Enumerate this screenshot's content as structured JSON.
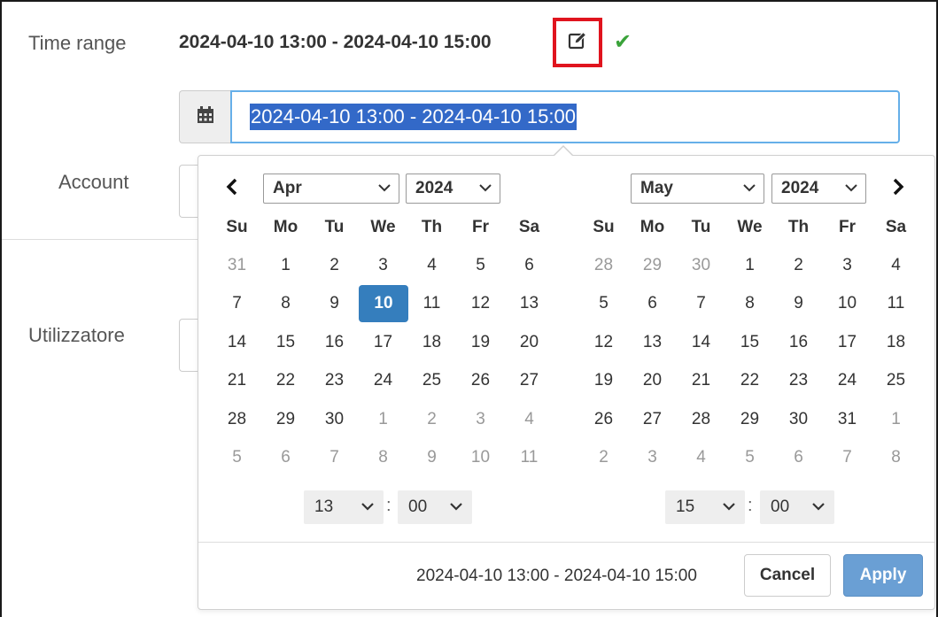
{
  "form": {
    "time_range_label": "Time range",
    "time_range_value": "2024-04-10 13:00 - 2024-04-10 15:00",
    "account_label": "Account",
    "user_label": "Utilizzatore",
    "date_input_value": "2024-04-10 13:00 - 2024-04-10 15:00"
  },
  "icons": {
    "edit": "edit-icon",
    "check": "check-icon",
    "calendar": "calendar-icon",
    "prev": "chevron-left-icon",
    "next": "chevron-right-icon"
  },
  "colors": {
    "highlight_border": "#e0141e",
    "check": "#3aa33a",
    "selection": "#3369c8",
    "active_day": "#357ebd",
    "apply": "#6a9fd4"
  },
  "picker": {
    "left": {
      "month": "Apr",
      "year": "2024",
      "weekdays": [
        "Su",
        "Mo",
        "Tu",
        "We",
        "Th",
        "Fr",
        "Sa"
      ],
      "weeks": [
        [
          "31",
          "1",
          "2",
          "3",
          "4",
          "5",
          "6"
        ],
        [
          "7",
          "8",
          "9",
          "10",
          "11",
          "12",
          "13"
        ],
        [
          "14",
          "15",
          "16",
          "17",
          "18",
          "19",
          "20"
        ],
        [
          "21",
          "22",
          "23",
          "24",
          "25",
          "26",
          "27"
        ],
        [
          "28",
          "29",
          "30",
          "1",
          "2",
          "3",
          "4"
        ],
        [
          "5",
          "6",
          "7",
          "8",
          "9",
          "10",
          "11"
        ]
      ],
      "active_day": "10",
      "hour": "13",
      "minute": "00"
    },
    "right": {
      "month": "May",
      "year": "2024",
      "weekdays": [
        "Su",
        "Mo",
        "Tu",
        "We",
        "Th",
        "Fr",
        "Sa"
      ],
      "weeks": [
        [
          "28",
          "29",
          "30",
          "1",
          "2",
          "3",
          "4"
        ],
        [
          "5",
          "6",
          "7",
          "8",
          "9",
          "10",
          "11"
        ],
        [
          "12",
          "13",
          "14",
          "15",
          "16",
          "17",
          "18"
        ],
        [
          "19",
          "20",
          "21",
          "22",
          "23",
          "24",
          "25"
        ],
        [
          "26",
          "27",
          "28",
          "29",
          "30",
          "31",
          "1"
        ],
        [
          "2",
          "3",
          "4",
          "5",
          "6",
          "7",
          "8"
        ]
      ],
      "hour": "15",
      "minute": "00"
    },
    "time_separator": ":",
    "footer_range": "2024-04-10 13:00 - 2024-04-10 15:00",
    "cancel_label": "Cancel",
    "apply_label": "Apply"
  }
}
